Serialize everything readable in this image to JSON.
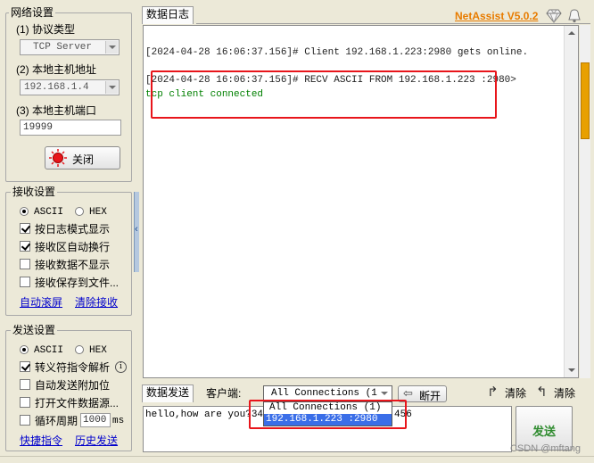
{
  "sidebar": {
    "network": {
      "title": "网络设置",
      "protocol_label": "(1) 协议类型",
      "protocol_value": "TCP Server",
      "host_label": "(2) 本地主机地址",
      "host_value": "192.168.1.4",
      "port_label": "(3) 本地主机端口",
      "port_value": "19999",
      "close_button": "关闭"
    },
    "receive": {
      "title": "接收设置",
      "ascii": "ASCII",
      "hex": "HEX",
      "opt_log_mode": "按日志模式显示",
      "opt_auto_wrap": "接收区自动换行",
      "opt_hide": "接收数据不显示",
      "opt_save_file": "接收保存到文件...",
      "link_auto_scroll": "自动滚屏",
      "link_clear": "清除接收"
    },
    "send": {
      "title": "发送设置",
      "ascii": "ASCII",
      "hex": "HEX",
      "opt_escape": "转义符指令解析",
      "opt_append": "自动发送附加位",
      "opt_open_file": "打开文件数据源...",
      "opt_cycle": "循环周期",
      "cycle_value": "1000",
      "cycle_unit": "ms",
      "link_shortcut": "快捷指令",
      "link_history": "历史发送"
    }
  },
  "header": {
    "tab_log": "数据日志",
    "brand": "NetAssist V5.0.2"
  },
  "log": {
    "lines": [
      "[2024-04-28 16:06:37.156]# Client 192.168.1.223:2980 gets online.",
      "[2024-04-28 16:06:37.156]# RECV ASCII FROM 192.168.1.223 :2980>",
      "tcp client connected"
    ]
  },
  "send_bar": {
    "tab_send": "数据发送",
    "client_label": "客户端:",
    "client_selected": "All Connections (1)",
    "dropdown_options": [
      "All Connections (1)",
      "192.168.1.223 :2980"
    ],
    "disconnect": "断开",
    "clear_left": "清除",
    "clear_right": "清除",
    "send_text": "hello,how are you?34034",
    "send_text_tail": "456",
    "send_button": "发送"
  },
  "watermark": "CSDN @mftang",
  "colors": {
    "brand": "#e87c00",
    "highlight_red": "#e8151b",
    "log_green": "#008000",
    "send_button_green": "#2e8b2e",
    "selection_blue": "#3a6ee8"
  }
}
